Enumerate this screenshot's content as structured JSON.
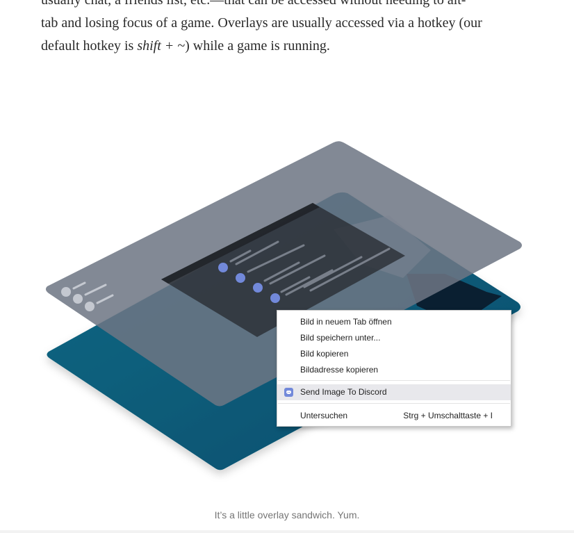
{
  "article": {
    "line1": "usually chat, a friends list, etc.—that can be accessed without needing to alt-",
    "line2": "tab and losing focus of a game. Overlays are usually accessed via a hotkey (our",
    "line3_before": "default hotkey is ",
    "line3_em": "shift + ~",
    "line3_after": ") while a game is running."
  },
  "figure": {
    "caption": "It’s a little overlay sandwich. Yum."
  },
  "context_menu": {
    "items": [
      {
        "label": "Bild in neuem Tab öffnen"
      },
      {
        "label": "Bild speichern unter..."
      },
      {
        "label": "Bild kopieren"
      },
      {
        "label": "Bildadresse kopieren"
      }
    ],
    "extension_item": {
      "label": "Send Image To Discord",
      "icon": "discord-icon"
    },
    "inspect_item": {
      "label": "Untersuchen",
      "shortcut": "Strg + Umschalttaste + I"
    }
  },
  "colors": {
    "bottom_panel": "#0a5f7d",
    "top_panel": "#6e7684",
    "overlay_window": "#2f3136",
    "accent_dots": "#7289da"
  }
}
